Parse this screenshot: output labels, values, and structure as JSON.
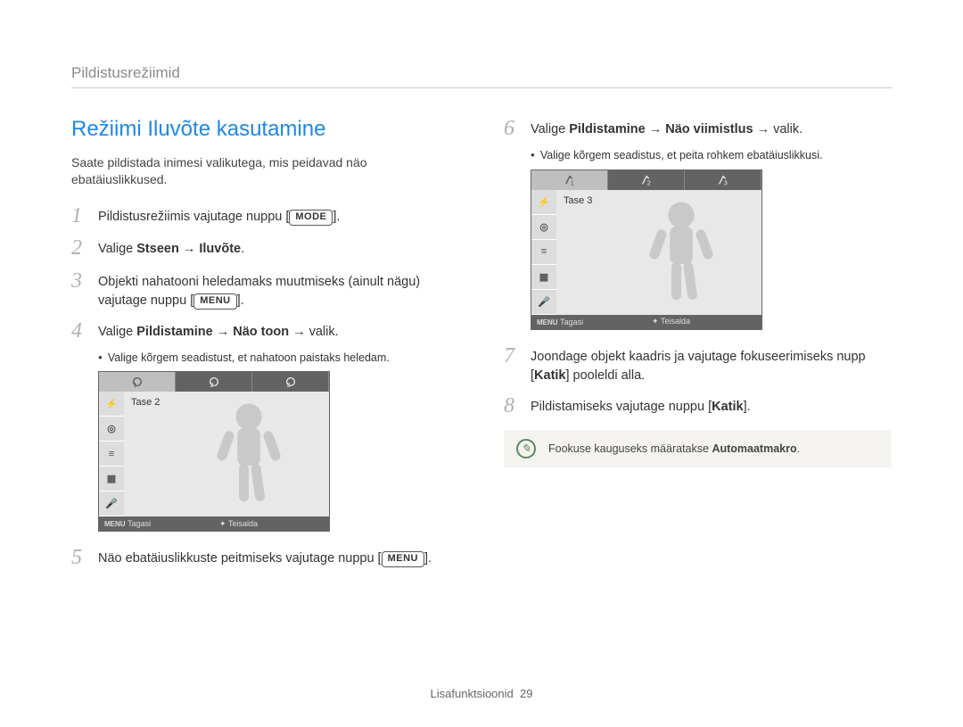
{
  "breadcrumb": "Pildistusrežiimid",
  "heading": "Režiimi Iluvõte kasutamine",
  "intro": "Saate pildistada inimesi valikutega, mis peidavad näo ebatäiuslikkused.",
  "steps": {
    "s1a": "Pildistusrežiimis vajutage nuppu [",
    "s1b": "].",
    "s2a": "Valige ",
    "s2b": "Stseen → Iluvõte",
    "s2c": ".",
    "s3a": "Objekti nahatooni heledamaks muutmiseks (ainult nägu) vajutage nuppu [",
    "s3b": "].",
    "s4a": "Valige ",
    "s4b": "Pildistamine → Näo toon",
    "s4c": " → valik.",
    "s4bullet": "Valige kõrgem seadistust, et nahatoon paistaks heledam.",
    "s5a": "Näo ebatäiuslikkuste peitmiseks vajutage nuppu [",
    "s5b": "].",
    "s6a": "Valige ",
    "s6b": "Pildistamine → Näo viimistlus",
    "s6c": " → valik.",
    "s6bullet": "Valige kõrgem seadistus, et peita rohkem ebatäiuslikkusi.",
    "s7a": "Joondage objekt kaadris ja vajutage fokuseerimiseks nupp [",
    "s7b": "Katik",
    "s7c": "] pooleldi alla.",
    "s8a": "Pildistamiseks vajutage nuppu [",
    "s8b": "Katik",
    "s8c": "]."
  },
  "labels": {
    "mode": "MODE",
    "menu": "MENU"
  },
  "shot1": {
    "tase": "Tase 2",
    "tagasi": "Tagasi",
    "teisalda": "Teisalda"
  },
  "shot2": {
    "tase": "Tase 3",
    "tagasi": "Tagasi",
    "teisalda": "Teisalda"
  },
  "note": {
    "a": "Fookuse kauguseks määratakse ",
    "b": "Automaatmakro",
    "c": "."
  },
  "footer": {
    "section": "Lisafunktsioonid",
    "page": "29"
  }
}
